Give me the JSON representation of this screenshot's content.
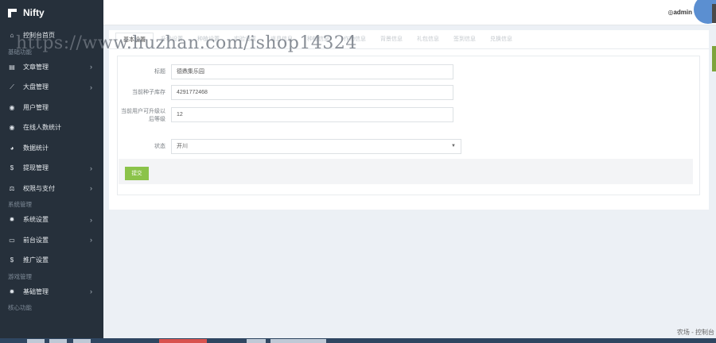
{
  "brand": {
    "name": "Nifty"
  },
  "sidebar": {
    "items": [
      {
        "icon": "home-icon",
        "glyph": "⌂",
        "label": "控制台首页",
        "arrow": ""
      },
      {
        "section": "基础功能"
      },
      {
        "icon": "document-icon",
        "glyph": "▤",
        "label": "文章管理",
        "arrow": "›"
      },
      {
        "icon": "chart-icon",
        "glyph": "⟋",
        "label": "大盘管理",
        "arrow": "›"
      },
      {
        "icon": "user-icon",
        "glyph": "◉",
        "label": "用户管理",
        "arrow": ""
      },
      {
        "icon": "online-icon",
        "glyph": "◉",
        "label": "在线人数统计",
        "arrow": ""
      },
      {
        "icon": "pie-chart-icon",
        "glyph": "◕",
        "label": "数据统计",
        "arrow": ""
      },
      {
        "icon": "dollar-icon",
        "glyph": "$",
        "label": "提现管理",
        "arrow": "›"
      },
      {
        "icon": "balance-icon",
        "glyph": "⚖",
        "label": "权限与支付",
        "arrow": "›"
      },
      {
        "section": "系统管理"
      },
      {
        "icon": "gear-icon",
        "glyph": "✹",
        "label": "系统设置",
        "arrow": "›"
      },
      {
        "icon": "monitor-icon",
        "glyph": "▭",
        "label": "前台设置",
        "arrow": "›"
      },
      {
        "icon": "dollar-icon",
        "glyph": "$",
        "label": "推广设置",
        "arrow": ""
      },
      {
        "section": "游戏管理"
      },
      {
        "icon": "gear-icon",
        "glyph": "✹",
        "label": "基础管理",
        "arrow": "›"
      },
      {
        "section": "核心功能"
      }
    ]
  },
  "header": {
    "user": "admin"
  },
  "tabs": [
    {
      "label": "基本设置",
      "active": true
    },
    {
      "label": "升级设置",
      "active": false
    },
    {
      "label": "种植设置",
      "active": false
    },
    {
      "label": "实验设置",
      "active": false
    },
    {
      "label": "道具信息",
      "active": false
    },
    {
      "label": "种植信息",
      "active": false
    },
    {
      "label": "作物信息",
      "active": false
    },
    {
      "label": "背景信息",
      "active": false
    },
    {
      "label": "礼包信息",
      "active": false
    },
    {
      "label": "签到信息",
      "active": false
    },
    {
      "label": "兑换信息",
      "active": false
    }
  ],
  "form": {
    "title_label": "标题",
    "title_value": "德鼎集乐园",
    "seed_label": "当前种子库存",
    "seed_value": "4291772468",
    "level_label": "当前用户可升级以后等级",
    "level_value": "12",
    "status_label": "状态",
    "status_value": "开川",
    "submit_label": "提交"
  },
  "watermark": "https://www.huzhan.com/ishop14324",
  "footer": {
    "text": "农场 - 控制台"
  }
}
